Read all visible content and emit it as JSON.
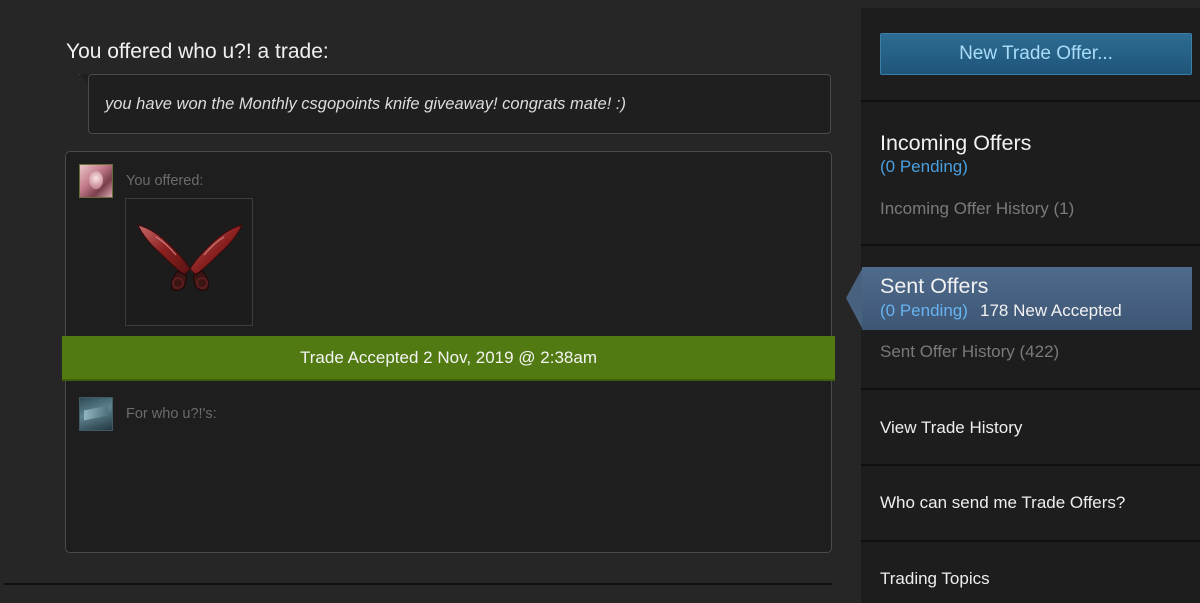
{
  "trade": {
    "headline": "You offered who u?! a trade:",
    "message": "you have won the Monthly csgopoints knife giveaway! congrats mate! :)",
    "you_offered_label": "You offered:",
    "for_them_label": "For who u?!'s:",
    "status_banner": "Trade Accepted 2 Nov, 2019 @ 2:38am",
    "item_icon": "shadow-daggers-knife-icon",
    "banner_color": "#527a12"
  },
  "sidebar": {
    "new_offer_button": "New Trade Offer...",
    "incoming": {
      "title": "Incoming Offers",
      "pending": "(0 Pending)",
      "history": "Incoming Offer History (1)"
    },
    "sent": {
      "title": "Sent Offers",
      "pending": "(0 Pending)",
      "accepted": "178 New Accepted",
      "history": "Sent Offer History (422)"
    },
    "links": {
      "view_history": "View Trade History",
      "who_can_send": "Who can send me Trade Offers?",
      "trading_topics": "Trading Topics"
    },
    "accent_color": "#4a9fe0",
    "button_color": "#2d6c93"
  }
}
